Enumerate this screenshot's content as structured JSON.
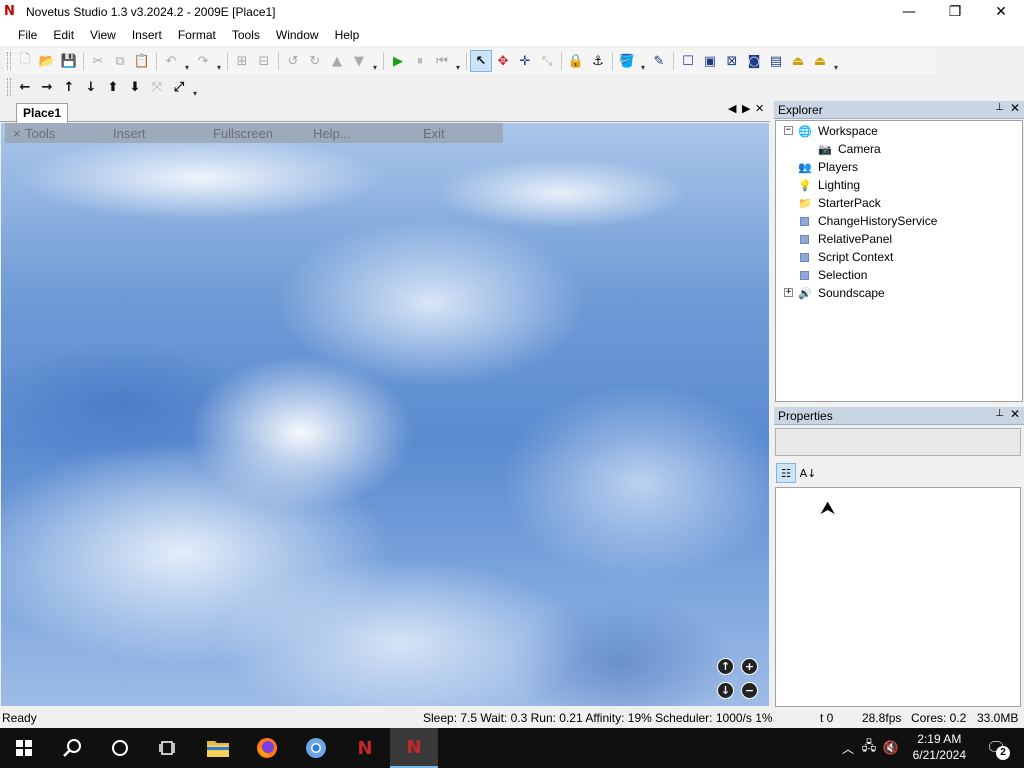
{
  "window": {
    "app_icon": "N",
    "title": "Novetus Studio 1.3 v3.2024.2 - 2009E [Place1]",
    "minimize_glyph": "—",
    "maximize_glyph": "❐",
    "close_glyph": "✕"
  },
  "menu": [
    "File",
    "Edit",
    "View",
    "Insert",
    "Format",
    "Tools",
    "Window",
    "Help"
  ],
  "toolbar": {
    "row1_icons": [
      "new-icon",
      "open-icon",
      "save-icon",
      "cut-icon",
      "copy-icon",
      "paste-icon",
      "undo-icon",
      "redo-icon",
      "group-icon",
      "ungroup-icon",
      "rotate-left-icon",
      "rotate-right-icon",
      "tilt-up-icon",
      "tilt-down-icon",
      "play-icon",
      "pause-icon",
      "stop-icon",
      "select-icon",
      "move-icon",
      "resize-icon",
      "scale-icon",
      "lock-icon",
      "anchor-icon",
      "paint-icon",
      "dropper-icon",
      "box-icon",
      "surface-icon",
      "weld-icon",
      "glue-icon",
      "motor-icon",
      "hinge-icon",
      "dropdown-icon"
    ],
    "row2_icons": [
      "arrow-left-icon",
      "arrow-right-icon",
      "arrow-up-icon",
      "arrow-down-icon",
      "move-up-icon",
      "move-down-icon",
      "expand-icon",
      "fit-icon"
    ]
  },
  "document": {
    "tab_label": "Place1",
    "tab_prev": "◀",
    "tab_next": "▶",
    "tab_close": "✕"
  },
  "viewport": {
    "gui_close": "×",
    "gui_items": [
      "Tools",
      "Insert",
      "Fullscreen",
      "Help...",
      "Exit"
    ],
    "camera_buttons": {
      "up": "↑",
      "down": "↓",
      "zoom_in": "+",
      "zoom_out": "−"
    }
  },
  "explorer": {
    "title": "Explorer",
    "pin_glyph": "📌",
    "close_glyph": "✕",
    "items": [
      {
        "label": "Workspace",
        "icon": "globe-icon",
        "expander": "−"
      },
      {
        "label": "Camera",
        "icon": "camera-icon"
      },
      {
        "label": "Players",
        "icon": "players-icon"
      },
      {
        "label": "Lighting",
        "icon": "lightbulb-icon"
      },
      {
        "label": "StarterPack",
        "icon": "folder-icon"
      },
      {
        "label": "ChangeHistoryService",
        "icon": "service-icon"
      },
      {
        "label": "RelativePanel",
        "icon": "service-icon"
      },
      {
        "label": "Script Context",
        "icon": "service-icon"
      },
      {
        "label": "Selection",
        "icon": "service-icon"
      },
      {
        "label": "Soundscape",
        "icon": "speaker-icon",
        "expander": "+"
      }
    ]
  },
  "properties": {
    "title": "Properties",
    "pin_glyph": "📌",
    "close_glyph": "✕",
    "categorized_glyph": "☷",
    "alphabetical_glyph": "A↓"
  },
  "statusbar": {
    "ready": "Ready",
    "stats": "Sleep: 7.5 Wait: 0.3 Run: 0.21 Affinity: 19% Scheduler: 1000/s 1%",
    "time": "t 0",
    "fps": "28.8fps",
    "cores": "Cores: 0.2",
    "memory": "33.0MB"
  },
  "taskbar": {
    "time": "2:19 AM",
    "date": "6/21/2024",
    "notification_count": "2"
  }
}
